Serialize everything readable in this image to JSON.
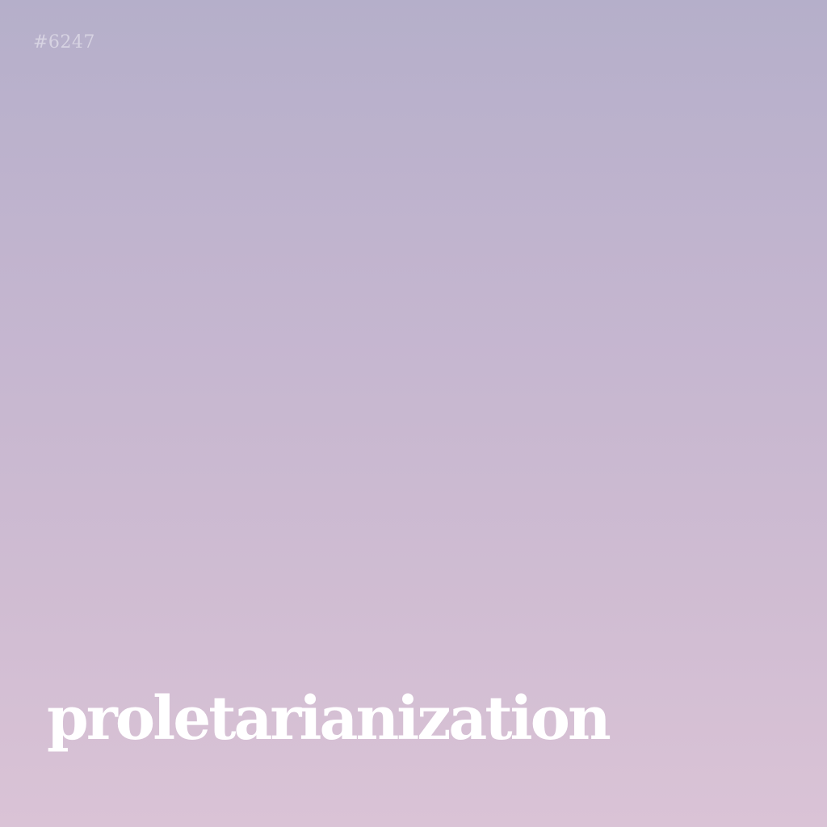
{
  "card": {
    "id_label": "#6247",
    "word": "proletarianization",
    "text_color": "#ffffff",
    "gradient_top": "#b5afca",
    "gradient_bottom": "#dac3d6"
  }
}
